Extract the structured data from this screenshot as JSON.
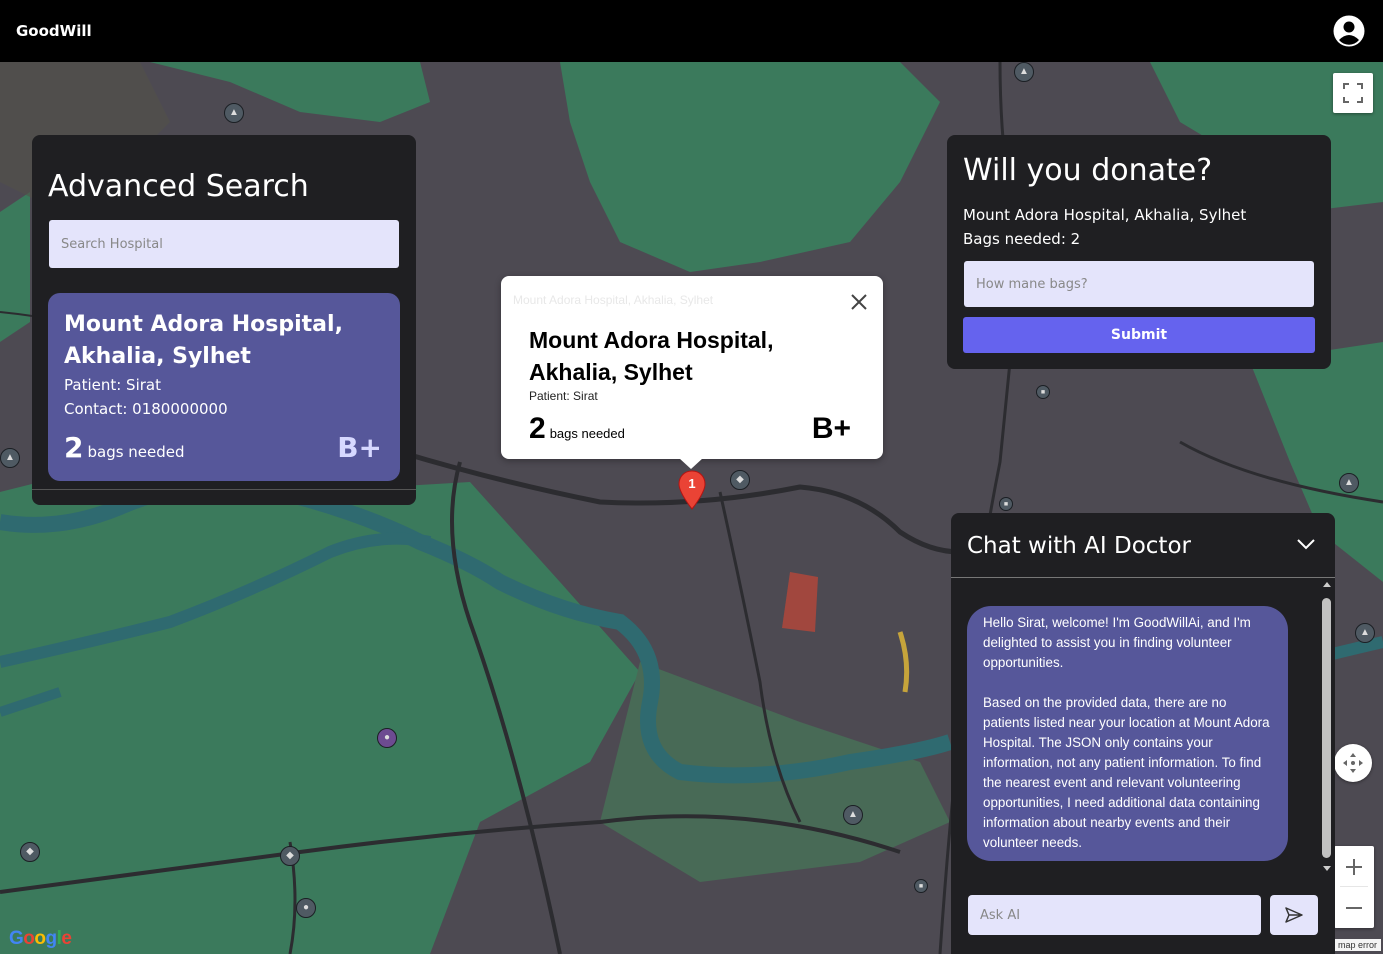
{
  "app": {
    "brand": "GoodWill"
  },
  "header": {
    "avatar_icon": "account-circle-icon"
  },
  "map": {
    "google_logo": "Google",
    "map_error": "map error",
    "marker_label": "1"
  },
  "search_panel": {
    "title": "Advanced Search",
    "search_placeholder": "Search Hospital",
    "results": [
      {
        "hospital": "Mount Adora Hospital, Akhalia, Sylhet",
        "patient": "Patient: Sirat",
        "contact": "Contact: 0180000000",
        "bags": "2",
        "bags_label": "bags needed",
        "blood_group": "B+"
      }
    ]
  },
  "info_window": {
    "ghost_title": "Mount Adora Hospital, Akhalia, Sylhet",
    "hospital": "Mount Adora Hospital, Akhalia, Sylhet",
    "patient": "Patient: Sirat",
    "bags": "2",
    "bags_label": "bags needed",
    "blood_group": "B+"
  },
  "donate_panel": {
    "title": "Will you donate?",
    "hospital": "Mount Adora Hospital, Akhalia, Sylhet",
    "bags_needed": "Bags needed: 2",
    "bags_placeholder": "How mane bags?",
    "submit_label": "Submit"
  },
  "chat_panel": {
    "title": "Chat with AI Doctor",
    "message": "Hello Sirat, welcome!  I'm GoodWillAi, and I'm delighted to assist you in finding volunteer opportunities.\n\nBased on the provided data, there are no patients listed near your location at Mount Adora Hospital.  The JSON only contains your information, not any patient information. To find the nearest event and relevant volunteering opportunities, I need additional data containing information about nearby events and their volunteer needs.",
    "input_placeholder": "Ask AI"
  },
  "colors": {
    "panel_bg": "#1f1f22",
    "card_bg": "#56579a",
    "accent": "#6563ee",
    "input_bg": "#e4e4fb",
    "map_land": "#4d4a52",
    "map_green": "#3b7a5c",
    "map_water": "#2f6a70"
  }
}
